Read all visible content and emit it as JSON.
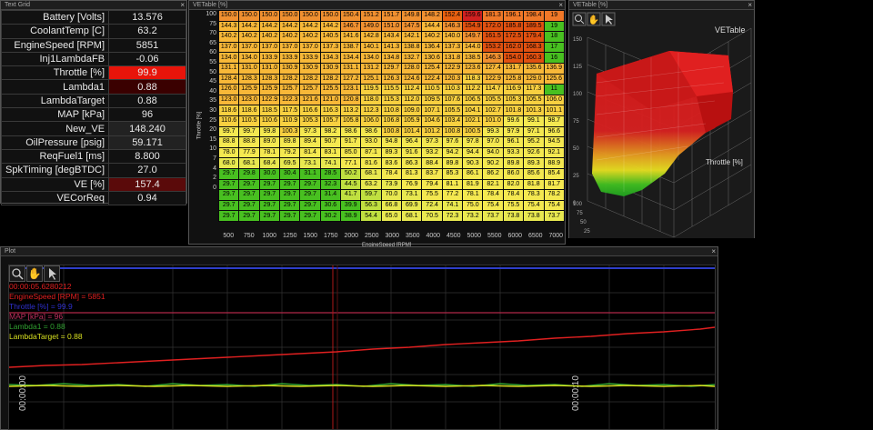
{
  "text_grid": {
    "title": "Text Grid",
    "rows": [
      {
        "label": "Battery [Volts]",
        "value": "13.576",
        "bg": "#111"
      },
      {
        "label": "CoolantTemp [C]",
        "value": "63.2",
        "bg": "#111"
      },
      {
        "label": "EngineSpeed [RPM]",
        "value": "5851",
        "bg": "#111"
      },
      {
        "label": "Inj1LambdaFB",
        "value": "-0.06",
        "bg": "#111"
      },
      {
        "label": "Throttle [%]",
        "value": "99.9",
        "bg": "#e8140a"
      },
      {
        "label": "Lambda1",
        "value": "0.88",
        "bg": "#3a0000"
      },
      {
        "label": "LambdaTarget",
        "value": "0.88",
        "bg": "#111"
      },
      {
        "label": "MAP [kPa]",
        "value": "96",
        "bg": "#111"
      },
      {
        "label": "New_VE",
        "value": "148.240",
        "bg": "#222"
      },
      {
        "label": "OilPressure [psig]",
        "value": "59.171",
        "bg": "#222"
      },
      {
        "label": "ReqFuel1 [ms]",
        "value": "8.800",
        "bg": "#111"
      },
      {
        "label": "SpkTiming [degBTDC]",
        "value": "27.0",
        "bg": "#111"
      },
      {
        "label": "VE [%]",
        "value": "157.4",
        "bg": "#5a0a0a"
      },
      {
        "label": "VECorReq",
        "value": "0.94",
        "bg": "#111"
      }
    ]
  },
  "ve_table": {
    "title": "VETable [%]",
    "x_axis_label": "EngineSpeed [RPM]",
    "y_axis_label": "Throttle [%]",
    "rpm": [
      "500",
      "750",
      "1000",
      "1250",
      "1500",
      "1750",
      "2000",
      "2500",
      "3000",
      "3500",
      "4000",
      "4500",
      "5000",
      "5500",
      "6000",
      "6500",
      "7000",
      "7500",
      "80"
    ],
    "throttle": [
      "100",
      "75",
      "70",
      "65",
      "60",
      "55",
      "50",
      "45",
      "40",
      "35",
      "30",
      "25",
      "20",
      "15",
      "10",
      "7",
      "4",
      "2",
      "0"
    ],
    "values": [
      [
        "150.0",
        "150.0",
        "150.0",
        "150.0",
        "150.0",
        "150.0",
        "150.4",
        "151.2",
        "151.7",
        "149.8",
        "148.2",
        "152.4",
        "159.6",
        "181.3",
        "196.1",
        "198.4",
        "19"
      ],
      [
        "144.3",
        "144.2",
        "144.2",
        "144.2",
        "144.2",
        "144.2",
        "146.7",
        "149.0",
        "151.0",
        "147.5",
        "144.4",
        "146.3",
        "154.9",
        "172.0",
        "185.8",
        "189.5",
        "19"
      ],
      [
        "140.2",
        "140.2",
        "140.2",
        "140.2",
        "140.2",
        "140.5",
        "141.6",
        "142.8",
        "143.4",
        "142.1",
        "140.2",
        "140.0",
        "149.7",
        "161.5",
        "172.5",
        "179.4",
        "18"
      ],
      [
        "137.0",
        "137.0",
        "137.0",
        "137.0",
        "137.0",
        "137.3",
        "138.7",
        "140.1",
        "141.3",
        "138.8",
        "136.4",
        "137.3",
        "144.0",
        "153.2",
        "162.0",
        "168.3",
        "17"
      ],
      [
        "134.0",
        "134.0",
        "133.9",
        "133.9",
        "133.9",
        "134.3",
        "134.4",
        "134.0",
        "134.8",
        "132.7",
        "130.6",
        "131.8",
        "138.5",
        "146.3",
        "154.0",
        "160.3",
        "16"
      ],
      [
        "131.1",
        "131.0",
        "131.0",
        "130.9",
        "130.9",
        "130.9",
        "131.1",
        "131.2",
        "129.7",
        "128.0",
        "125.4",
        "122.9",
        "123.6",
        "127.4",
        "131.7",
        "135.6",
        "136.9"
      ],
      [
        "128.4",
        "128.3",
        "128.3",
        "128.2",
        "128.2",
        "128.2",
        "127.2",
        "125.1",
        "126.3",
        "124.6",
        "122.4",
        "120.3",
        "118.3",
        "122.9",
        "125.8",
        "129.0",
        "125.6"
      ],
      [
        "126.0",
        "125.9",
        "125.9",
        "125.7",
        "125.7",
        "125.5",
        "123.1",
        "119.5",
        "115.5",
        "112.4",
        "110.5",
        "110.3",
        "112.2",
        "114.7",
        "116.9",
        "117.3",
        "11"
      ],
      [
        "123.0",
        "123.0",
        "122.9",
        "122.3",
        "121.6",
        "121.0",
        "120.8",
        "118.0",
        "115.3",
        "112.0",
        "109.5",
        "107.6",
        "106.5",
        "105.5",
        "105.3",
        "105.5",
        "106.0"
      ],
      [
        "118.6",
        "118.6",
        "118.5",
        "117.5",
        "116.6",
        "116.3",
        "113.2",
        "112.3",
        "110.8",
        "109.0",
        "107.1",
        "105.5",
        "104.1",
        "102.7",
        "101.8",
        "101.3",
        "101.1"
      ],
      [
        "110.6",
        "110.5",
        "110.6",
        "110.9",
        "105.3",
        "105.7",
        "105.8",
        "106.0",
        "106.8",
        "105.9",
        "104.6",
        "103.4",
        "102.1",
        "101.0",
        "99.6",
        "99.1",
        "98.7"
      ],
      [
        "99.7",
        "99.7",
        "99.8",
        "100.3",
        "97.3",
        "98.2",
        "98.6",
        "98.6",
        "100.8",
        "101.4",
        "101.2",
        "100.8",
        "100.5",
        "99.3",
        "97.9",
        "97.1",
        "96.6"
      ],
      [
        "88.8",
        "88.8",
        "89.0",
        "89.8",
        "89.4",
        "90.7",
        "91.7",
        "93.0",
        "94.8",
        "96.4",
        "97.3",
        "97.6",
        "97.8",
        "97.0",
        "96.1",
        "95.2",
        "94.5"
      ],
      [
        "78.0",
        "77.9",
        "78.1",
        "79.2",
        "81.4",
        "83.1",
        "85.0",
        "87.1",
        "89.3",
        "91.6",
        "93.2",
        "94.2",
        "94.4",
        "94.0",
        "93.3",
        "92.6",
        "92.1"
      ],
      [
        "68.0",
        "68.1",
        "68.4",
        "69.5",
        "73.1",
        "74.1",
        "77.1",
        "81.6",
        "83.6",
        "86.3",
        "88.4",
        "89.8",
        "90.3",
        "90.2",
        "89.8",
        "89.3",
        "88.9"
      ],
      [
        "29.7",
        "29.8",
        "30.0",
        "30.4",
        "31.1",
        "28.5",
        "50.2",
        "68.1",
        "78.4",
        "81.3",
        "83.7",
        "85.3",
        "86.1",
        "86.2",
        "86.0",
        "85.6",
        "85.4"
      ],
      [
        "29.7",
        "29.7",
        "29.7",
        "29.7",
        "29.7",
        "32.3",
        "44.5",
        "63.2",
        "73.9",
        "76.9",
        "79.4",
        "81.1",
        "81.9",
        "82.1",
        "82.0",
        "81.8",
        "81.7"
      ],
      [
        "29.7",
        "29.7",
        "29.7",
        "29.7",
        "29.7",
        "31.4",
        "41.7",
        "59.7",
        "70.0",
        "73.1",
        "75.5",
        "77.2",
        "78.1",
        "78.4",
        "78.4",
        "78.3",
        "78.2"
      ],
      [
        "29.7",
        "29.7",
        "29.7",
        "29.7",
        "29.7",
        "30.6",
        "39.9",
        "56.3",
        "66.8",
        "69.9",
        "72.4",
        "74.1",
        "75.0",
        "75.4",
        "75.5",
        "75.4",
        "75.4"
      ],
      [
        "29.7",
        "29.7",
        "29.7",
        "29.7",
        "29.7",
        "30.2",
        "38.9",
        "54.4",
        "65.0",
        "68.1",
        "70.5",
        "72.3",
        "73.2",
        "73.7",
        "73.8",
        "73.8",
        "73.7"
      ]
    ]
  },
  "ve_3d": {
    "title": "VETable [%]",
    "header": "VETable",
    "axis_label": "Throttle [%]",
    "y_ticks": [
      "150",
      "125",
      "100",
      "75",
      "50",
      "25",
      "0"
    ],
    "depth_ticks": [
      "100",
      "75",
      "50",
      "25"
    ]
  },
  "plot": {
    "title": "Plot",
    "legend": [
      {
        "text": "00:00:05.6280212",
        "color": "#e02020"
      },
      {
        "text": "EngineSpeed [RPM] = 5851",
        "color": "#e02020"
      },
      {
        "text": "Throttle [%] = 99.9",
        "color": "#3030d0"
      },
      {
        "text": "MAP [kPa] = 96",
        "color": "#c03060"
      },
      {
        "text": "Lambda1 = 0.88",
        "color": "#30a030"
      },
      {
        "text": "LambdaTarget = 0.88",
        "color": "#d8e020"
      }
    ],
    "time_labels": [
      "00:00:00",
      "00:00:10"
    ],
    "tools": [
      "zoom-icon",
      "pan-icon",
      "cursor-icon"
    ]
  }
}
